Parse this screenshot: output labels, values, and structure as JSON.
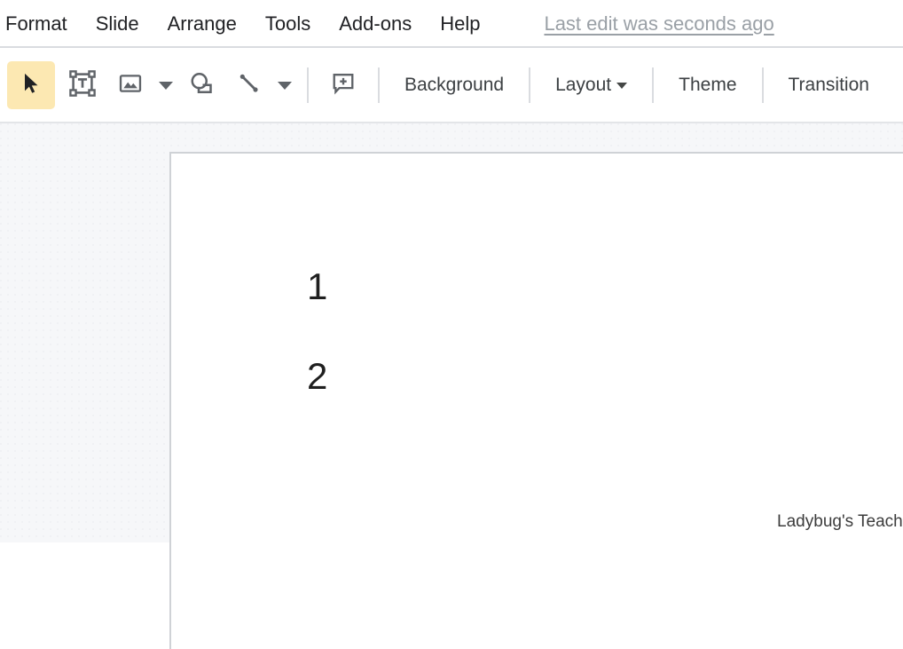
{
  "menubar": {
    "items": [
      {
        "label": "Format",
        "name": "menu-format"
      },
      {
        "label": "Slide",
        "name": "menu-slide"
      },
      {
        "label": "Arrange",
        "name": "menu-arrange"
      },
      {
        "label": "Tools",
        "name": "menu-tools"
      },
      {
        "label": "Add-ons",
        "name": "menu-addons"
      },
      {
        "label": "Help",
        "name": "menu-help"
      }
    ],
    "last_edit_status": "Last edit was seconds ago"
  },
  "toolbar": {
    "icons": [
      {
        "name": "select-cursor-icon",
        "active": true
      },
      {
        "name": "text-box-icon",
        "active": false
      },
      {
        "name": "insert-image-icon",
        "active": false
      },
      {
        "name": "shape-icon",
        "active": false
      },
      {
        "name": "line-icon",
        "active": false
      },
      {
        "name": "add-comment-icon",
        "active": false
      }
    ],
    "background_label": "Background",
    "layout_label": "Layout",
    "theme_label": "Theme",
    "transition_label": "Transition"
  },
  "slide": {
    "items": [
      {
        "text": "1"
      },
      {
        "text": "2"
      }
    ],
    "watermark": "Ladybug's Teacher Files"
  },
  "colors": {
    "tool_active_bg": "#fce8b2",
    "icon_gray": "#5f6368",
    "menu_text": "#202124",
    "muted_text": "#9aa0a6",
    "divider": "#dadce0",
    "workspace_bg": "#f6f7f9",
    "slide_bg": "#ffffff",
    "slide_border": "#cfd2d6"
  }
}
